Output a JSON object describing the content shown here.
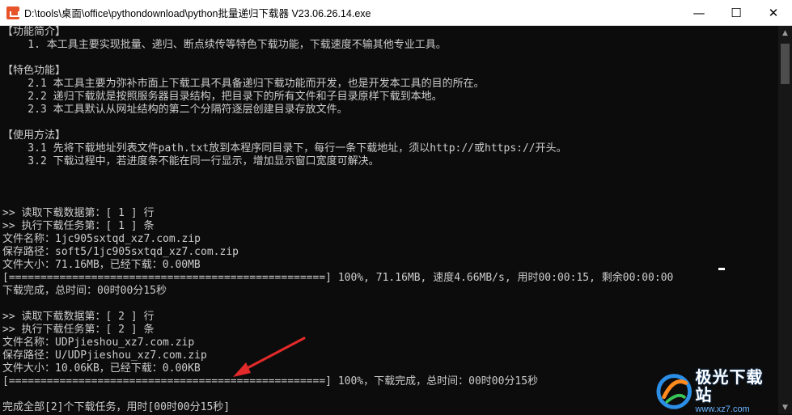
{
  "window": {
    "title": "D:\\tools\\桌面\\office\\pythondownload\\python批量递归下载器 V23.06.26.14.exe",
    "icon": "app-download-icon",
    "minimize_glyph": "—",
    "maximize_glyph": "☐",
    "close_glyph": "✕"
  },
  "console": {
    "lines": [
      "【功能简介】",
      "    1. 本工具主要实现批量、递归、断点续传等特色下载功能，下载速度不输其他专业工具。",
      "",
      "【特色功能】",
      "    2.1 本工具主要为弥补市面上下载工具不具备递归下载功能而开发，也是开发本工具的目的所在。",
      "    2.2 递归下载就是按照服务器目录结构，把目录下的所有文件和子目录原样下载到本地。",
      "    2.3 本工具默认从网址结构的第二个分隔符逐层创建目录存放文件。",
      "",
      "【使用方法】",
      "    3.1 先将下载地址列表文件path.txt放到本程序同目录下，每行一条下载地址，须以http://或https://开头。",
      "    3.2 下载过程中，若进度条不能在同一行显示，增加显示窗口宽度可解决。",
      "",
      "",
      "",
      ">> 读取下载数据第：[ 1 ] 行",
      ">> 执行下载任务第：[ 1 ] 条",
      "文件名称：1jc905sxtqd_xz7.com.zip",
      "保存路径：soft5/1jc905sxtqd_xz7.com.zip",
      "文件大小：71.16MB，已经下载：0.00MB",
      "[==================================================] 100%, 71.16MB, 速度4.66MB/s, 用时00:00:15, 剩余00:00:00",
      "下载完成，总时间：00时00分15秒",
      "",
      ">> 读取下载数据第：[ 2 ] 行",
      ">> 执行下载任务第：[ 2 ] 条",
      "文件名称：UDPjieshou_xz7.com.zip",
      "保存路径：U/UDPjieshou_xz7.com.zip",
      "文件大小：10.06KB，已经下载：0.00KB",
      "[==================================================] 100%，下载完成，总时间：00时00分15秒",
      "",
      "完成全部[2]个下载任务，用时[00时00分15秒]"
    ]
  },
  "scrollbar": {
    "up_glyph": "▲",
    "down_glyph": "▼"
  },
  "watermark": {
    "brand_cn": "极光下载站",
    "url": "www.xz7.com"
  },
  "colors": {
    "console_bg": "#0c0c0c",
    "console_text": "#cccccc",
    "annotation_arrow": "#e32a2a",
    "titlebar_bg": "#ffffff"
  }
}
